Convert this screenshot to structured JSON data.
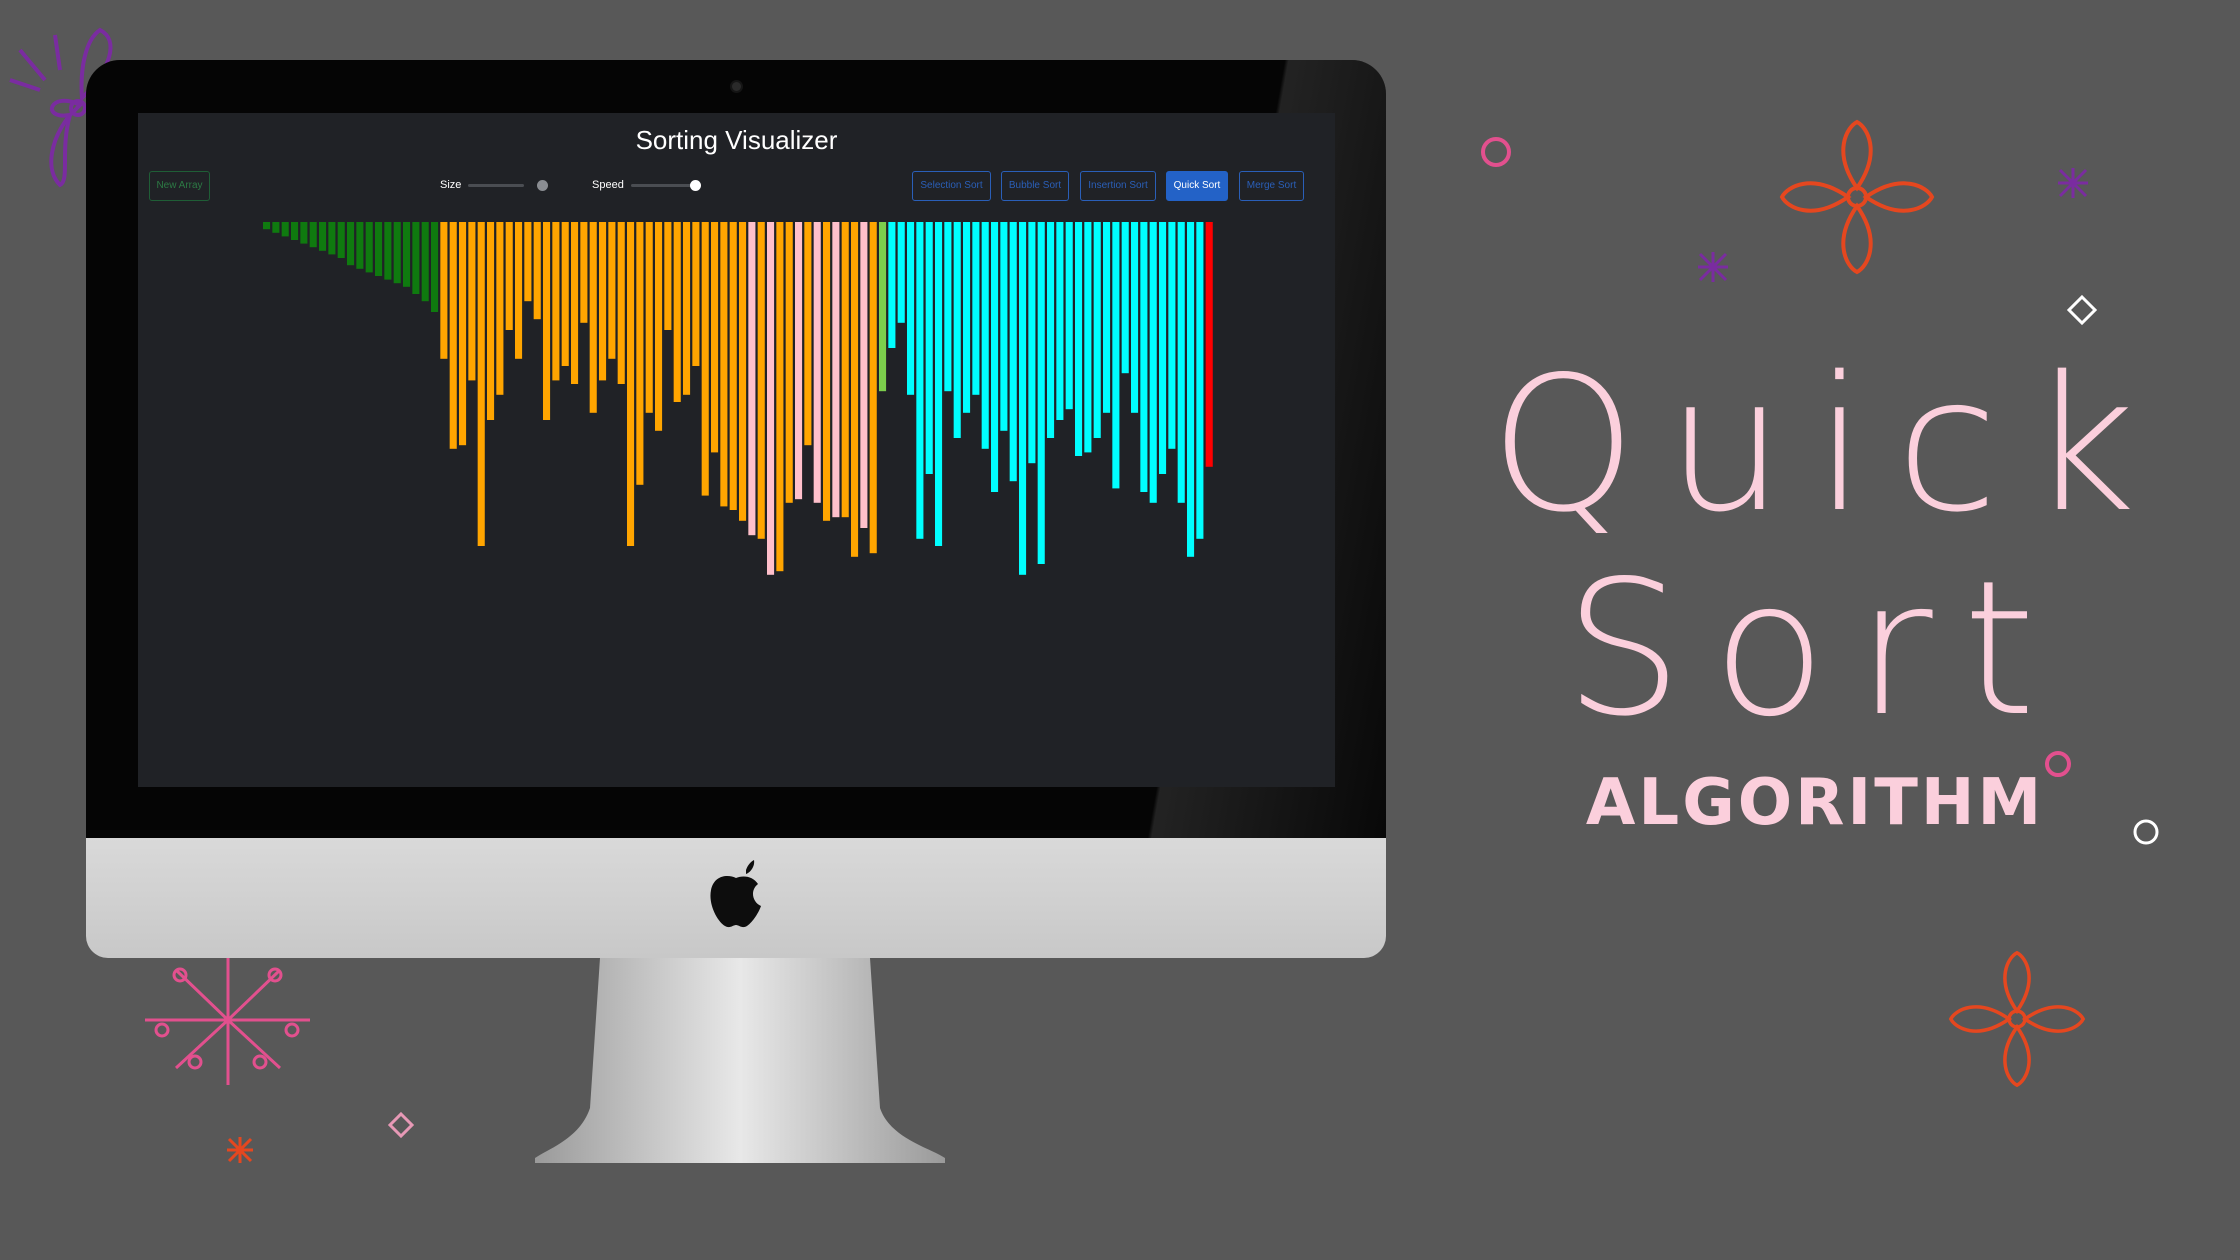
{
  "app": {
    "title": "Sorting Visualizer",
    "new_array_label": "New Array",
    "size_label": "Size",
    "speed_label": "Speed",
    "algorithms": [
      "Selection Sort",
      "Bubble Sort",
      "Insertion Sort",
      "Quick Sort",
      "Merge Sort"
    ],
    "active_algorithm": "Quick Sort",
    "size_slider_value": 0.9,
    "speed_slider_value": 0.55
  },
  "promo": {
    "title_line1": "Quick",
    "title_line2": "Sort",
    "subtitle": "ALGORITHM"
  },
  "colors": {
    "background": "#585858",
    "screen_bg": "#202226",
    "sorted": "#0f7a0f",
    "partition": "#ffa500",
    "compared": "#ffc0cb",
    "unsorted": "#00ffff",
    "pivot": "#ff0000",
    "boundary": "#7ccf4c",
    "accent_blue": "#2362c7",
    "promo_text": "#fbcfdc"
  },
  "chart_data": {
    "type": "bar",
    "orientation": "hanging",
    "note_states": [
      "sorted",
      "partition",
      "compared",
      "boundary",
      "unsorted",
      "pivot"
    ],
    "values": [
      2,
      3,
      4,
      5,
      6,
      7,
      8,
      9,
      10,
      12,
      13,
      14,
      15,
      16,
      17,
      18,
      20,
      22,
      25,
      38,
      63,
      62,
      44,
      90,
      55,
      48,
      30,
      38,
      22,
      27,
      55,
      44,
      40,
      45,
      28,
      53,
      44,
      38,
      45,
      90,
      73,
      53,
      58,
      30,
      50,
      48,
      40,
      76,
      64,
      79,
      80,
      83,
      87,
      88,
      98,
      97,
      78,
      77,
      62,
      78,
      83,
      82,
      82,
      93,
      85,
      92,
      47,
      35,
      28,
      48,
      88,
      70,
      90,
      47,
      60,
      53,
      48,
      63,
      75,
      58,
      72,
      98,
      67,
      95,
      60,
      55,
      52,
      65,
      64,
      60,
      53,
      74,
      42,
      53,
      75,
      78,
      70,
      63,
      78,
      93,
      88,
      68
    ],
    "states": [
      "sorted",
      "sorted",
      "sorted",
      "sorted",
      "sorted",
      "sorted",
      "sorted",
      "sorted",
      "sorted",
      "sorted",
      "sorted",
      "sorted",
      "sorted",
      "sorted",
      "sorted",
      "sorted",
      "sorted",
      "sorted",
      "sorted",
      "partition",
      "partition",
      "partition",
      "partition",
      "partition",
      "partition",
      "partition",
      "partition",
      "partition",
      "partition",
      "partition",
      "partition",
      "partition",
      "partition",
      "partition",
      "partition",
      "partition",
      "partition",
      "partition",
      "partition",
      "partition",
      "partition",
      "partition",
      "partition",
      "partition",
      "partition",
      "partition",
      "partition",
      "partition",
      "partition",
      "partition",
      "partition",
      "partition",
      "compared",
      "partition",
      "compared",
      "partition",
      "partition",
      "compared",
      "partition",
      "compared",
      "partition",
      "compared",
      "partition",
      "partition",
      "compared",
      "partition",
      "boundary",
      "unsorted",
      "unsorted",
      "unsorted",
      "unsorted",
      "unsorted",
      "unsorted",
      "unsorted",
      "unsorted",
      "unsorted",
      "unsorted",
      "unsorted",
      "unsorted",
      "unsorted",
      "unsorted",
      "unsorted",
      "unsorted",
      "unsorted",
      "unsorted",
      "unsorted",
      "unsorted",
      "unsorted",
      "unsorted",
      "unsorted",
      "unsorted",
      "unsorted",
      "unsorted",
      "unsorted",
      "unsorted",
      "unsorted",
      "unsorted",
      "unsorted",
      "unsorted",
      "unsorted",
      "unsorted",
      "pivot"
    ],
    "ylim": [
      0,
      100
    ]
  }
}
